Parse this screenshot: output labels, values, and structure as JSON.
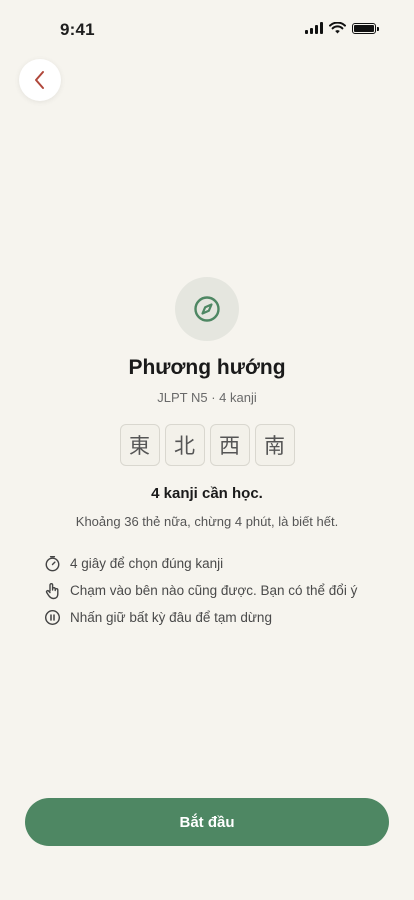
{
  "status_bar": {
    "time": "9:41"
  },
  "topic": {
    "icon": "compass-icon",
    "title": "Phương hướng",
    "subtitle": "JLPT N5 · 4 kanji"
  },
  "kanji": [
    "東",
    "北",
    "西",
    "南"
  ],
  "summary": {
    "count_text": "4 kanji cần học.",
    "detail": "Khoảng 36 thẻ nữa, chừng 4 phút, là biết hết."
  },
  "tips": [
    {
      "icon": "timer-icon",
      "text": "4 giây để chọn đúng kanji"
    },
    {
      "icon": "tap-hand-icon",
      "text": "Chạm vào bên nào cũng được. Bạn có thể đổi ý"
    },
    {
      "icon": "pause-icon",
      "text": "Nhấn giữ bất kỳ đâu để tạm dừng"
    }
  ],
  "start_button": {
    "label": "Bắt đầu"
  },
  "colors": {
    "background": "#f6f4ee",
    "accent_green": "#4e8763",
    "back_chevron": "#b0473a"
  }
}
